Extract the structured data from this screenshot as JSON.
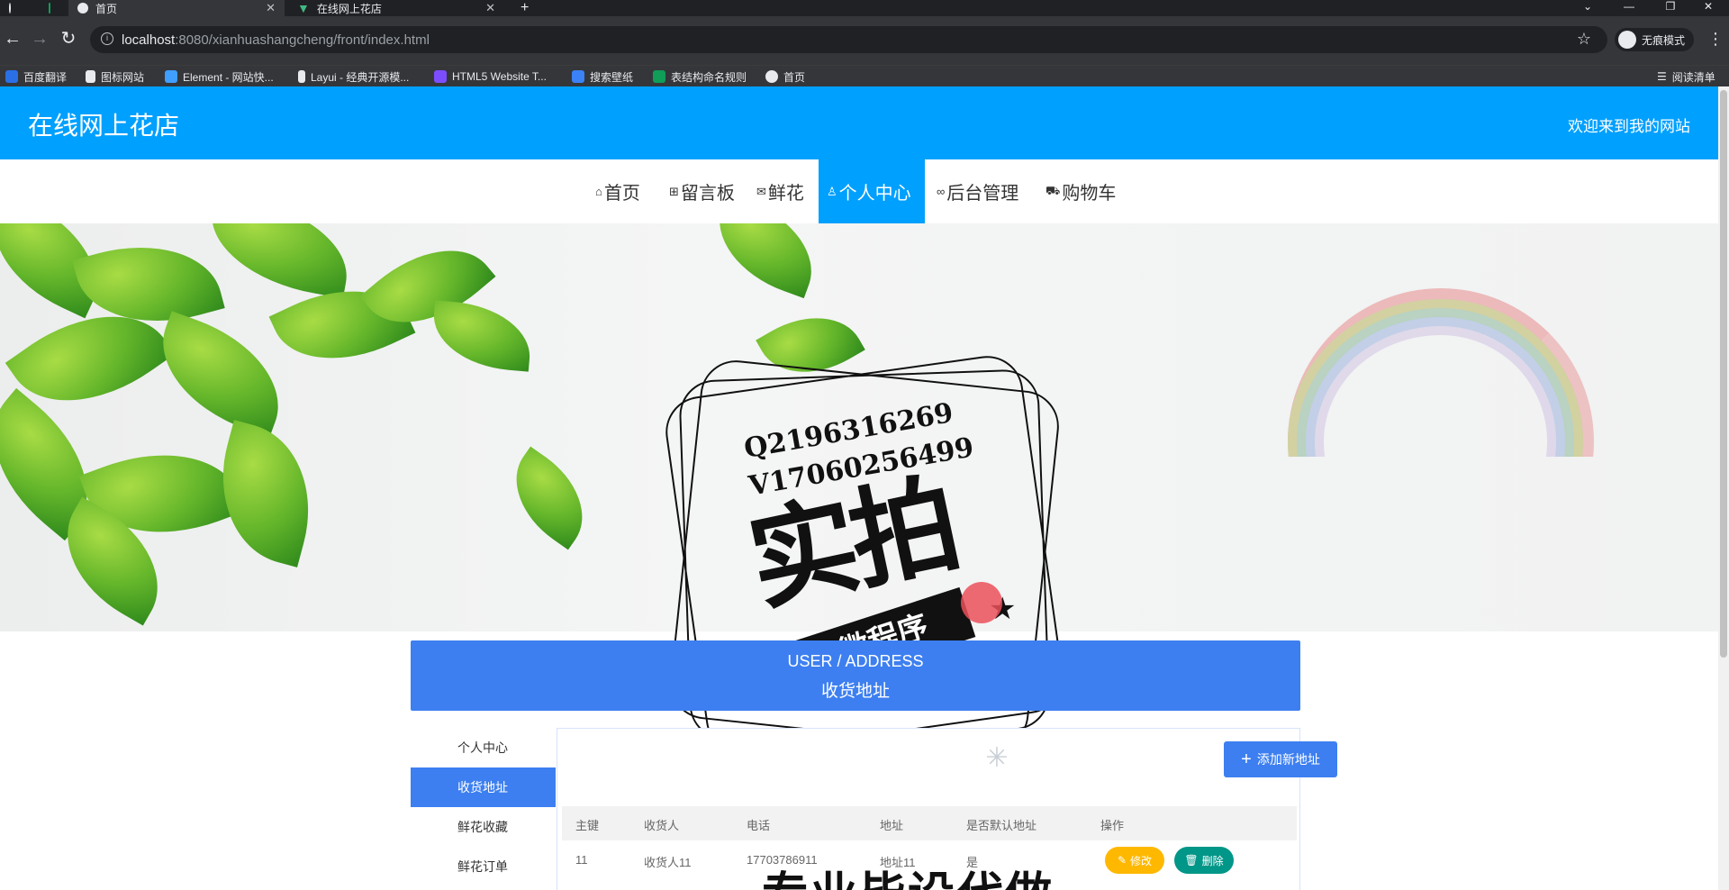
{
  "browser": {
    "tabs": [
      {
        "label": "首页",
        "icon": "globe-icon",
        "active": true
      },
      {
        "label": "在线网上花店",
        "icon": "vue-icon",
        "active": false
      }
    ],
    "new_tab": "+",
    "url_host": "localhost",
    "url_rest": ":8080/xianhuashangcheng/front/index.html",
    "incognito_label": "无痕模式",
    "bookmarks": [
      {
        "label": "百度翻译",
        "color": "#2b6fe6"
      },
      {
        "label": "图标网站",
        "color": "#e8eaed"
      },
      {
        "label": "Element - 网站快...",
        "color": "#409eff"
      },
      {
        "label": "Layui - 经典开源模...",
        "color": "#e8eaed"
      },
      {
        "label": "HTML5 Website T...",
        "color": "#7c4dff"
      },
      {
        "label": "搜索壁纸",
        "color": "#3b82f6"
      },
      {
        "label": "表结构命名规则",
        "color": "#0f9d58"
      },
      {
        "label": "首页",
        "color": "#e8eaed"
      }
    ],
    "reading_list": "阅读清单"
  },
  "header": {
    "title": "在线网上花店",
    "welcome": "欢迎来到我的网站",
    "bg_color": "#00a0ff"
  },
  "nav": {
    "items": [
      {
        "label": "首页",
        "icon": "home-icon",
        "active": false
      },
      {
        "label": "留言板",
        "icon": "gift-icon",
        "active": false
      },
      {
        "label": "鲜花",
        "icon": "mail-icon",
        "active": false
      },
      {
        "label": "个人中心",
        "icon": "user-icon",
        "active": true
      },
      {
        "label": "后台管理",
        "icon": "link-icon",
        "active": false
      },
      {
        "label": "购物车",
        "icon": "cart-icon",
        "active": false
      }
    ]
  },
  "banner": {
    "carousel_active_index": 0,
    "carousel_count": 3
  },
  "watermark": {
    "line1": "Q2196316269",
    "line2": "V17060256499",
    "big": "实拍",
    "ribbon": "全微程序",
    "bottom": "专业毕设代做"
  },
  "section": {
    "en": "USER / ADDRESS",
    "cn": "收货地址",
    "accent": "#3d7ff0"
  },
  "sidemenu": {
    "items": [
      {
        "label": "个人中心",
        "active": false
      },
      {
        "label": "收货地址",
        "active": true
      },
      {
        "label": "鲜花收藏",
        "active": false
      },
      {
        "label": "鲜花订单",
        "active": false
      }
    ]
  },
  "addresses": {
    "add_button": "添加新地址",
    "columns": [
      "主键",
      "收货人",
      "电话",
      "地址",
      "是否默认地址",
      "操作"
    ],
    "rows": [
      {
        "id": "11",
        "receiver": "收货人11",
        "phone": "17703786911",
        "address": "地址11",
        "is_default": "是"
      }
    ],
    "edit_label": "修改",
    "delete_label": "删除",
    "edit_color": "#ffb800",
    "delete_color": "#009688"
  }
}
